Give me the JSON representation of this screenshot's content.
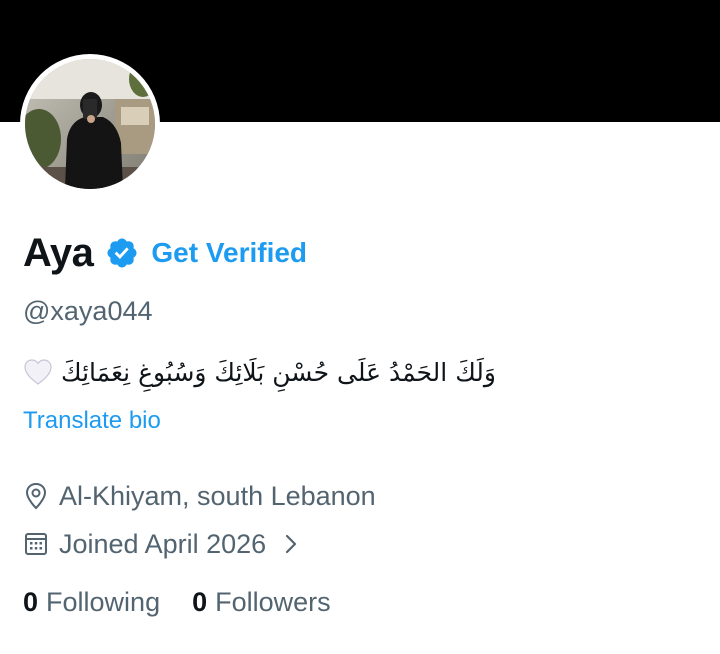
{
  "profile": {
    "display_name": "Aya",
    "get_verified_label": "Get Verified",
    "handle": "@xaya044",
    "bio": "وَلَكَ الحَمْدُ عَلَى حُسْنِ بَلَائِكَ وَسُبُوغِ نِعَمَائِكَ",
    "translate_label": "Translate bio",
    "location": "Al-Khiyam, south Lebanon",
    "joined": "Joined April 2026"
  },
  "stats": {
    "following_count": "0",
    "following_label": "Following",
    "followers_count": "0",
    "followers_label": "Followers"
  },
  "icons": {
    "verified": "verified-badge-icon",
    "heart": "white-heart-icon",
    "location": "location-pin-icon",
    "calendar": "calendar-icon",
    "chevron": "chevron-right-icon"
  },
  "colors": {
    "accent": "#1d9bf0",
    "text_primary": "#0f1419",
    "text_secondary": "#536471",
    "banner": "#000000"
  }
}
